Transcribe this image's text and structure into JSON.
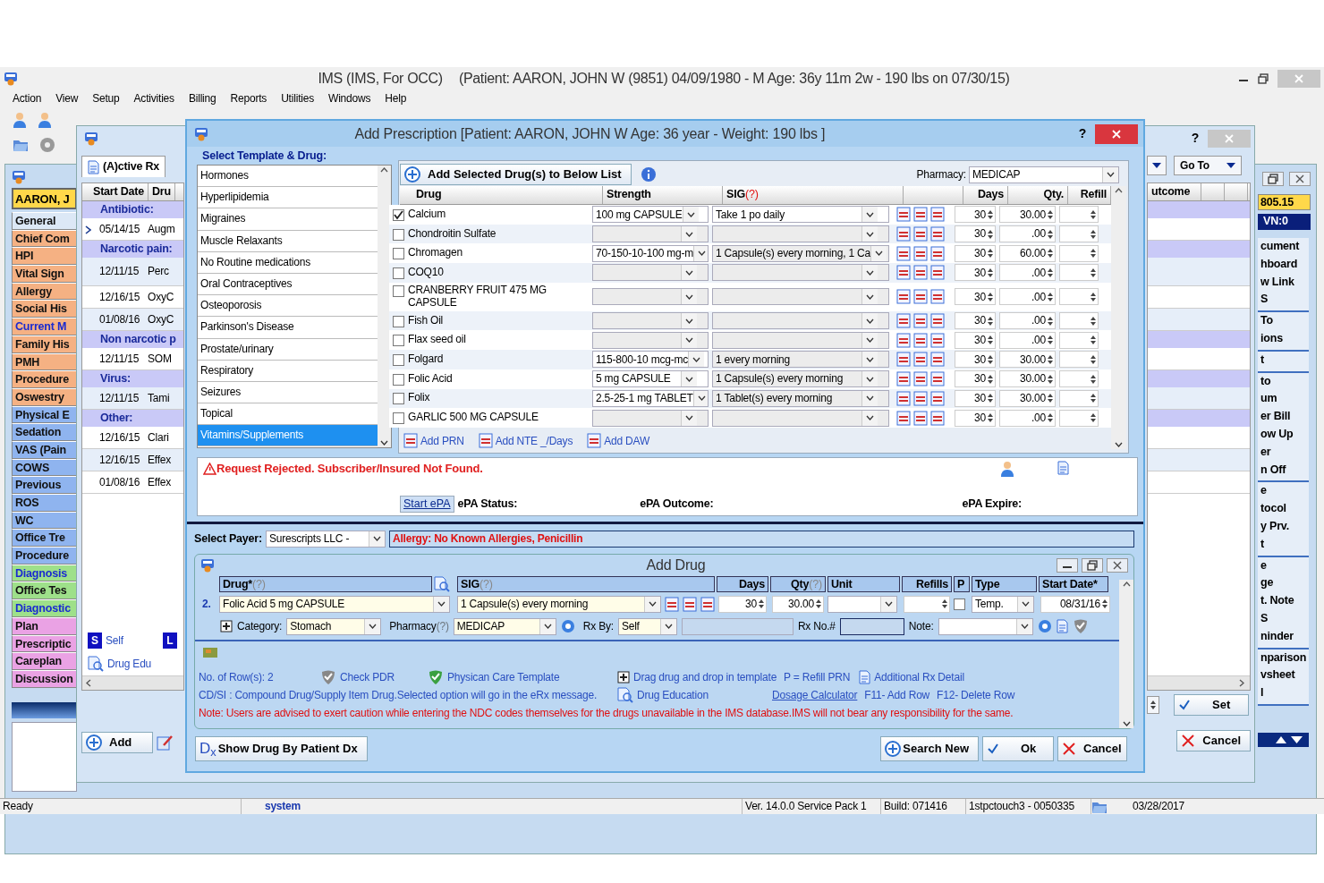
{
  "app": {
    "title": "IMS (IMS, For OCC)",
    "patient_info": "(Patient: AARON, JOHN W (9851) 04/09/1980 - M Age: 36y 11m 2w - 190 lbs on 07/30/15)"
  },
  "menu": [
    "Action",
    "View",
    "Setup",
    "Activities",
    "Billing",
    "Reports",
    "Utilities",
    "Windows",
    "Help"
  ],
  "nav": {
    "patient": "AARON, J",
    "items": [
      {
        "label": "General",
        "color": "#dce8f6",
        "emphasized": false
      },
      {
        "label": "Chief Com",
        "color": "#f5b183",
        "emphasized": false
      },
      {
        "label": "HPI",
        "color": "#f5b183",
        "emphasized": false
      },
      {
        "label": "Vital Sign",
        "color": "#f5b183",
        "emphasized": false
      },
      {
        "label": "Allergy",
        "color": "#f5b183",
        "emphasized": false
      },
      {
        "label": "Social His",
        "color": "#f5b183",
        "emphasized": false
      },
      {
        "label": "Current M",
        "color": "#f5b183",
        "emphasized": true
      },
      {
        "label": "Family His",
        "color": "#f5b183",
        "emphasized": false
      },
      {
        "label": "PMH",
        "color": "#f5b183",
        "emphasized": false
      },
      {
        "label": "Procedure",
        "color": "#f5b183",
        "emphasized": false
      },
      {
        "label": "Oswestry",
        "color": "#f5b183",
        "emphasized": false
      },
      {
        "label": "Physical E",
        "color": "#8fb4ef",
        "emphasized": false
      },
      {
        "label": "Sedation",
        "color": "#8fb4ef",
        "emphasized": false
      },
      {
        "label": "VAS (Pain",
        "color": "#8fb4ef",
        "emphasized": false
      },
      {
        "label": "COWS",
        "color": "#8fb4ef",
        "emphasized": false
      },
      {
        "label": "Previous",
        "color": "#8fb4ef",
        "emphasized": false
      },
      {
        "label": "ROS",
        "color": "#8fb4ef",
        "emphasized": false
      },
      {
        "label": "WC",
        "color": "#8fb4ef",
        "emphasized": false
      },
      {
        "label": "Office Tre",
        "color": "#8fb4ef",
        "emphasized": false
      },
      {
        "label": "Procedure",
        "color": "#8fb4ef",
        "emphasized": false
      },
      {
        "label": "Diagnosis",
        "color": "#9ee08a",
        "emphasized": true
      },
      {
        "label": "Office Tes",
        "color": "#9ee08a",
        "emphasized": false
      },
      {
        "label": "Diagnostic",
        "color": "#9ee08a",
        "emphasized": true
      },
      {
        "label": "Plan",
        "color": "#eaa2e4",
        "emphasized": false
      },
      {
        "label": "Prescriptic",
        "color": "#eaa2e4",
        "emphasized": false
      },
      {
        "label": "Careplan",
        "color": "#eaa2e4",
        "emphasized": false
      },
      {
        "label": "Discussion",
        "color": "#eaa2e4",
        "emphasized": false
      }
    ]
  },
  "rx_window": {
    "help": "?",
    "tab": "(A)ctive Rx",
    "columns": [
      "Start Date",
      "Dru"
    ],
    "groups": [
      {
        "name": "Antibiotic:",
        "rows": [
          {
            "date": "05/14/15",
            "drug": "Augm",
            "current": true
          }
        ]
      },
      {
        "name": "Narcotic pain:",
        "rows": [
          {
            "date": "12/11/15",
            "drug": "Perc",
            "current": false
          },
          {
            "date": "12/16/15",
            "drug": "OxyC",
            "current": false
          },
          {
            "date": "01/08/16",
            "drug": "OxyC",
            "current": false
          }
        ]
      },
      {
        "name": "Non narcotic p",
        "rows": [
          {
            "date": "12/11/15",
            "drug": "SOM",
            "current": false
          }
        ]
      },
      {
        "name": "Virus:",
        "rows": [
          {
            "date": "12/11/15",
            "drug": "Tami",
            "current": false
          }
        ]
      },
      {
        "name": "Other:",
        "rows": [
          {
            "date": "12/16/15",
            "drug": "Clari",
            "current": false
          },
          {
            "date": "12/16/15",
            "drug": "Effex",
            "current": false
          },
          {
            "date": "01/08/16",
            "drug": "Effex",
            "current": false
          }
        ]
      }
    ],
    "self_badge": "S",
    "self_label": "Self",
    "l_badge": "L",
    "drug_edu": "Drug Edu",
    "add": "Add",
    "go_to": "Go To",
    "outcome_column": "utcome",
    "set": "Set",
    "cancel": "Cancel"
  },
  "right_panel": {
    "amount": "805.15",
    "visit": "VN:0",
    "groups": [
      [
        "cument",
        "hboard",
        "w Link",
        "S"
      ],
      [
        "To",
        "ions"
      ],
      [
        "t"
      ],
      [
        "to",
        "um",
        "er Bill",
        "ow Up",
        "er",
        "n Off"
      ],
      [
        "e",
        "tocol",
        "y Prv.",
        "t"
      ],
      [
        "e",
        "ge",
        "t. Note",
        "S",
        "ninder"
      ],
      [
        "nparison",
        "vsheet",
        "l"
      ]
    ]
  },
  "dialog": {
    "title": "Add Prescription  [Patient: AARON, JOHN W  Age: 36 year  - Weight: 190 lbs ]",
    "help": "?",
    "templates": {
      "label": "Select Template & Drug:",
      "items": [
        {
          "label": "Hormones",
          "selected": false
        },
        {
          "label": "Hyperlipidemia",
          "selected": false
        },
        {
          "label": "Migraines",
          "selected": false
        },
        {
          "label": "Muscle Relaxants",
          "selected": false
        },
        {
          "label": "No Routine medications",
          "selected": false
        },
        {
          "label": "Oral Contraceptives",
          "selected": false
        },
        {
          "label": "Osteoporosis",
          "selected": false
        },
        {
          "label": "Parkinson's Disease",
          "selected": false
        },
        {
          "label": "Prostate/urinary",
          "selected": false
        },
        {
          "label": "Respiratory",
          "selected": false
        },
        {
          "label": "Seizures",
          "selected": false
        },
        {
          "label": "Topical",
          "selected": false
        },
        {
          "label": "Vitamins/Supplements",
          "selected": true
        }
      ]
    },
    "drug_list": {
      "add_button": "Add Selected Drug(s) to Below List",
      "pharmacy_label": "Pharmacy:",
      "pharmacy": "MEDICAP",
      "columns": [
        "Drug",
        "Strength",
        "SIG",
        "Days",
        "Qty.",
        "Refill"
      ],
      "sig_help": "(?)",
      "rows": [
        {
          "checked": true,
          "drug": "Calcium",
          "strength": "100 mg CAPSULE",
          "sig": "Take 1 po daily",
          "days": "30",
          "qty": "30.00"
        },
        {
          "checked": false,
          "drug": "Chondroitin Sulfate",
          "days": "30",
          "qty": ".00"
        },
        {
          "checked": false,
          "drug": "Chromagen",
          "strength": "70-150-10-100 mg-m",
          "sig": "1 Capsule(s) every morning,  1 Ca",
          "days": "30",
          "qty": "60.00"
        },
        {
          "checked": false,
          "drug": "COQ10",
          "days": "30",
          "qty": ".00"
        },
        {
          "checked": false,
          "drug": "CRANBERRY FRUIT 475 MG CAPSULE",
          "days": "30",
          "qty": ".00"
        },
        {
          "checked": false,
          "drug": "Fish Oil",
          "days": "30",
          "qty": ".00"
        },
        {
          "checked": false,
          "drug": "Flax seed oil",
          "days": "30",
          "qty": ".00"
        },
        {
          "checked": false,
          "drug": "Folgard",
          "strength": "115-800-10 mcg-mc",
          "sig": "1 every morning",
          "days": "30",
          "qty": "30.00"
        },
        {
          "checked": false,
          "drug": "Folic Acid",
          "strength": "5 mg CAPSULE",
          "sig": "1 Capsule(s) every morning",
          "days": "30",
          "qty": "30.00"
        },
        {
          "checked": false,
          "drug": "Folix",
          "strength": "2.5-25-1 mg TABLET",
          "sig": "1 Tablet(s) every morning",
          "days": "30",
          "qty": "30.00"
        },
        {
          "checked": false,
          "drug": "GARLIC 500 MG CAPSULE",
          "days": "30",
          "qty": ".00"
        }
      ],
      "links": [
        "Add PRN",
        "Add NTE _/Days",
        "Add DAW"
      ]
    },
    "epa": {
      "message": "Request Rejected. Subscriber/Insured Not Found.",
      "start": "Start ePA",
      "status": "ePA Status:",
      "outcome": "ePA Outcome:",
      "expire": "ePA Expire:"
    },
    "payer": {
      "label": "Select Payer:",
      "value": "Surescripts LLC -",
      "allergy": "Allergy: No Known Allergies, Penicillin"
    },
    "add_drug": {
      "title": "Add Drug",
      "columns": [
        {
          "label": "Drug*",
          "help": "(?)"
        },
        {
          "label": "SIG",
          "help": "(?)"
        },
        {
          "label": "Days"
        },
        {
          "label": "Qty",
          "help": "(?)"
        },
        {
          "label": "Unit"
        },
        {
          "label": "Refills"
        },
        {
          "label": "P"
        },
        {
          "label": "Type"
        },
        {
          "label": "Start Date*"
        }
      ],
      "row": {
        "number": "2.",
        "drug": "Folic Acid 5 mg CAPSULE",
        "sig": "1 Capsule(s) every morning",
        "days": "30",
        "qty": "30.00",
        "refill_prn": false,
        "type": "Temp.",
        "start_date": "08/31/16"
      },
      "category_label": "Category:",
      "category": "Stomach",
      "pharmacy_label": "Pharmacy",
      "pharmacy_help": "(?)",
      "pharmacy": "MEDICAP",
      "rx_by_label": "Rx By:",
      "rx_by": "Self",
      "rx_no_label": "Rx No.#",
      "note_label": "Note:",
      "row_count": "No. of Row(s): 2",
      "check_pdr": "Check PDR",
      "care_template": "Physican Care Template",
      "drag_hint": "Drag drug and drop in template",
      "refill_hint": "P = Refill PRN",
      "additional": "Additional Rx Detail",
      "cdsi": "CD/SI : Compound Drug/Supply Item Drug.Selected option will go in the eRx message.",
      "drug_education": "Drug Education",
      "dosage_calculator": "Dosage Calculator",
      "add_row": "F11- Add Row",
      "delete_row": "F12- Delete Row",
      "note": "Note: Users are advised to exert caution while entering the NDC codes themselves for the drugs unavailable in the IMS database.IMS will not bear any responsibility for the same."
    },
    "buttons": {
      "dx_mark": "D$_{x}$",
      "dx": "Show Drug By Patient Dx",
      "search_new": "Search New",
      "ok": "Ok",
      "cancel": "Cancel"
    }
  },
  "status_bar": [
    "Ready",
    "system",
    "Ver. 14.0.0 Service Pack 1",
    "Build: 071416",
    "1stpctouch3 - 0050335",
    "03/28/2017"
  ]
}
